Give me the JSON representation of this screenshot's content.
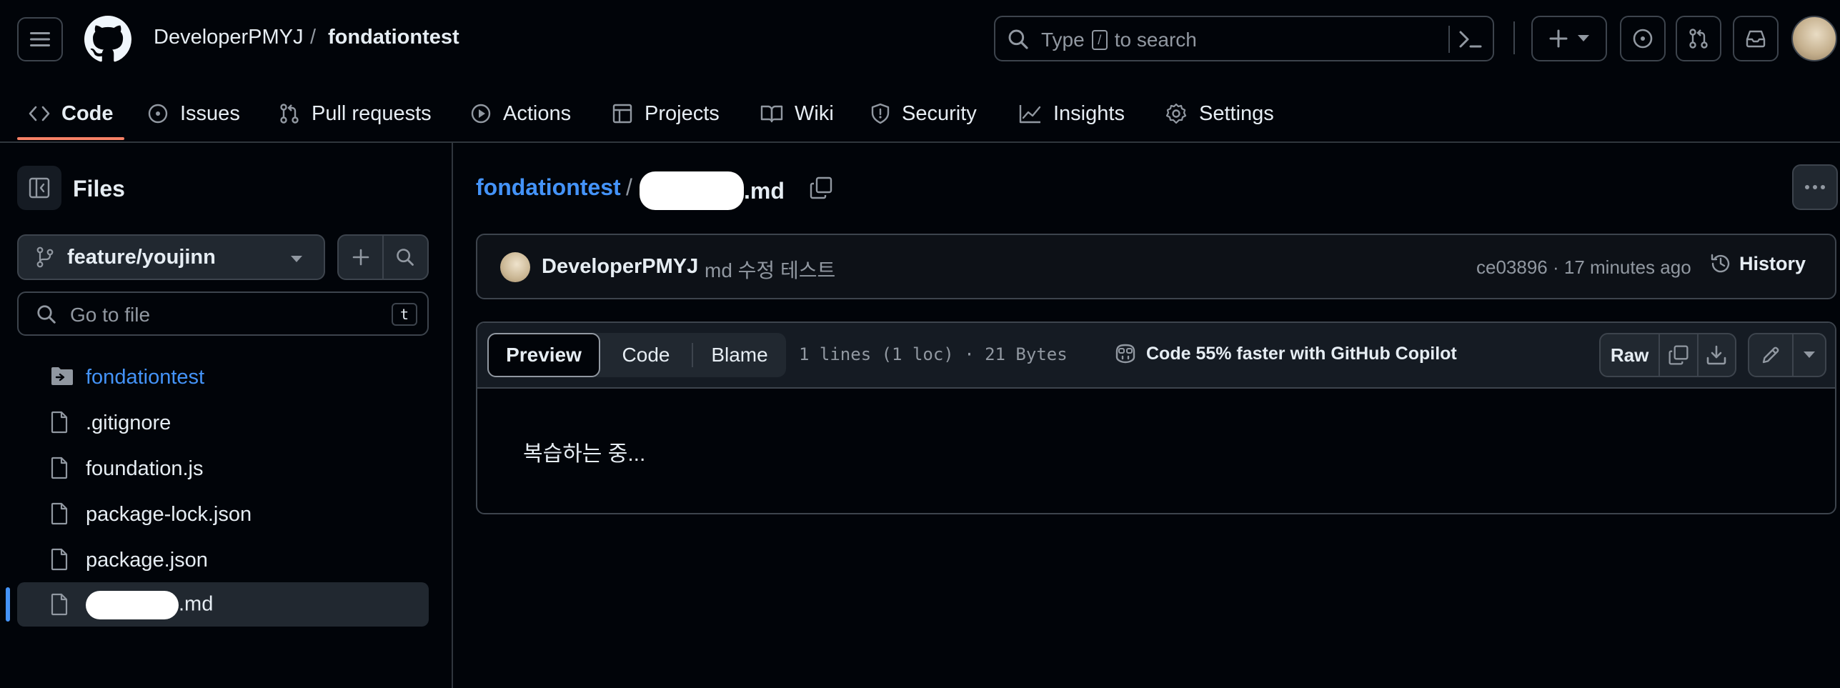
{
  "header": {
    "owner": "DeveloperPMYJ",
    "separator": "/",
    "repo": "fondationtest",
    "search": {
      "prefix": "Type",
      "key": "/",
      "suffix": "to search"
    }
  },
  "repo_nav": {
    "tabs": [
      {
        "label": "Code",
        "icon": "code-icon",
        "active": true
      },
      {
        "label": "Issues",
        "icon": "issue-opened-icon"
      },
      {
        "label": "Pull requests",
        "icon": "git-pull-request-icon"
      },
      {
        "label": "Actions",
        "icon": "play-icon"
      },
      {
        "label": "Projects",
        "icon": "table-icon"
      },
      {
        "label": "Wiki",
        "icon": "book-icon"
      },
      {
        "label": "Security",
        "icon": "shield-icon"
      },
      {
        "label": "Insights",
        "icon": "graph-icon"
      },
      {
        "label": "Settings",
        "icon": "gear-icon"
      }
    ]
  },
  "sidebar": {
    "title": "Files",
    "branch": "feature/youjinn",
    "goto_placeholder": "Go to file",
    "goto_shortcut": "t",
    "tree": [
      {
        "label": "fondationtest",
        "type": "folder"
      },
      {
        "label": ".gitignore",
        "type": "file"
      },
      {
        "label": "foundation.js",
        "type": "file"
      },
      {
        "label": "package-lock.json",
        "type": "file"
      },
      {
        "label": "package.json",
        "type": "file"
      },
      {
        "label": ".md",
        "type": "file",
        "selected": true,
        "redacted_prefix": true
      }
    ]
  },
  "main": {
    "breadcrumb_repo": "fondationtest",
    "breadcrumb_sep": "/",
    "file_suffix": ".md",
    "commit": {
      "author": "DeveloperPMYJ",
      "message": "md 수정 테스트",
      "meta": "ce03896 · 17 minutes ago",
      "history_label": "History"
    },
    "file_view": {
      "tabs": [
        "Preview",
        "Code",
        "Blame"
      ],
      "active_tab": "Preview",
      "stats": "1 lines (1 loc) · 21 Bytes",
      "copilot_text": "Code 55% faster with GitHub Copilot",
      "raw_label": "Raw",
      "content": "복습하는 중..."
    }
  },
  "colors": {
    "bg": "#010409",
    "link": "#4493f8",
    "active_underline": "#f78166",
    "border": "#3d444d",
    "muted": "#9198a1"
  }
}
